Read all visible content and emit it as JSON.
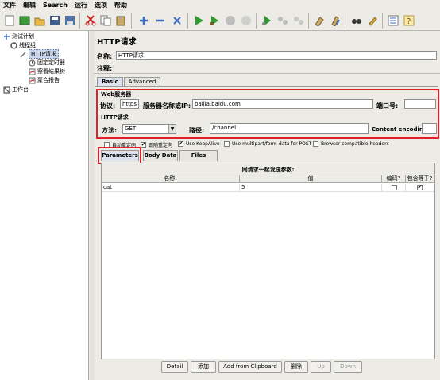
{
  "menubar": {
    "items": [
      "文件",
      "编辑",
      "Search",
      "运行",
      "选项",
      "帮助"
    ]
  },
  "toolbar": {
    "icons": [
      "new-icon",
      "templates-icon",
      "open-icon",
      "save-icon",
      "save-as-icon",
      "cut-icon",
      "copy-icon",
      "paste-icon",
      "expand-icon",
      "collapse-icon",
      "toggle-icon",
      "start-icon",
      "start-no-pauses-icon",
      "stop-icon",
      "shutdown-icon",
      "remote-start-icon",
      "remote-stop-icon",
      "remote-shutdown-icon",
      "clear-icon",
      "clear-all-icon",
      "search-icon",
      "reset-search-icon",
      "function-helper-icon",
      "help-icon"
    ]
  },
  "tree": {
    "test_plan": "测试计划",
    "thread_group": "线程组",
    "http_request": "HTTP请求",
    "timer": "固定定时器",
    "results_tree": "察看结果树",
    "aggregate_report": "聚合报告",
    "workbench": "工作台"
  },
  "panel": {
    "title": "HTTP请求",
    "name_label": "名称:",
    "name_value": "HTTP请求",
    "comment_label": "注释:",
    "tabs": [
      "Basic",
      "Advanced"
    ],
    "web_server_group": "Web服务器",
    "protocol_label": "协议:",
    "protocol_value": "https",
    "server_label": "服务器名称或IP:",
    "server_value": "baijia.baidu.com",
    "port_label": "端口号:",
    "port_value": "",
    "http_request_group": "HTTP请求",
    "method_label": "方法:",
    "method_value": "GET",
    "path_label": "路径:",
    "path_value": "/channel",
    "encoding_label": "Content encoding:",
    "encoding_value": "",
    "options": [
      {
        "label": "自动重定向",
        "checked": false
      },
      {
        "label": "跟随重定向",
        "checked": true
      },
      {
        "label": "Use KeepAlive",
        "checked": true
      },
      {
        "label": "Use multipart/form-data for POST",
        "checked": false
      },
      {
        "label": "Browser-compatible headers",
        "checked": false
      }
    ],
    "param_tabs": [
      "Parameters",
      "Body Data",
      "Files Upload"
    ],
    "table_caption": "同请求一起发送参数:",
    "columns": [
      "名称:",
      "值",
      "编码?",
      "包含等于?"
    ],
    "rows": [
      {
        "name": "cat",
        "value": "5",
        "encode": false,
        "include_equals": true
      }
    ],
    "buttons": [
      {
        "label": "Detail",
        "enabled": true
      },
      {
        "label": "添加",
        "enabled": true
      },
      {
        "label": "Add from Clipboard",
        "enabled": true
      },
      {
        "label": "删除",
        "enabled": true
      },
      {
        "label": "Up",
        "enabled": false
      },
      {
        "label": "Down",
        "enabled": false
      }
    ]
  }
}
